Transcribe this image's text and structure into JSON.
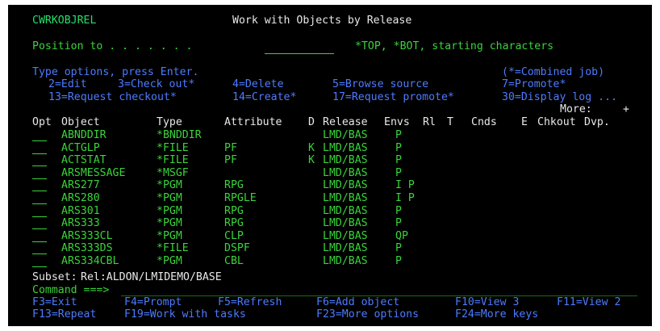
{
  "header": {
    "program": "CWRKOBJREL",
    "title": "Work with Objects by Release"
  },
  "position": {
    "label": "Position to . . . . . . .",
    "hint": "*TOP, *BOT, starting characters"
  },
  "instructions": {
    "text": "Type options, press Enter.",
    "combined": "(*=Combined job)"
  },
  "options_row1": [
    "2=Edit",
    "3=Check out*",
    "4=Delete",
    "5=Browse source",
    "7=Promote*"
  ],
  "options_row2": [
    "13=Request checkout*",
    "14=Create*",
    "17=Request promote*",
    "30=Display log ..."
  ],
  "more": "More:",
  "more_plus": "+",
  "columns": {
    "opt": "Opt",
    "object": "Object",
    "type": "Type",
    "attribute": "Attribute",
    "d": "D",
    "release": "Release",
    "envs": "Envs",
    "rl": "Rl",
    "t": "T",
    "cnds": "Cnds",
    "e": "E",
    "chkout": "Chkout",
    "dvp": "Dvp."
  },
  "rows": [
    {
      "object": "ABNDDIR",
      "type": "*BNDDIR",
      "attribute": "",
      "d": "",
      "release": "LMD/BAS",
      "envs": "P"
    },
    {
      "object": "ACTGLP",
      "type": "*FILE",
      "attribute": "PF",
      "d": "K",
      "release": "LMD/BAS",
      "envs": "P"
    },
    {
      "object": "ACTSTAT",
      "type": "*FILE",
      "attribute": "PF",
      "d": "K",
      "release": "LMD/BAS",
      "envs": "P"
    },
    {
      "object": "ARSMESSAGE",
      "type": "*MSGF",
      "attribute": "",
      "d": "",
      "release": "LMD/BAS",
      "envs": "P"
    },
    {
      "object": "ARS277",
      "type": "*PGM",
      "attribute": "RPG",
      "d": "",
      "release": "LMD/BAS",
      "envs": "I P"
    },
    {
      "object": "ARS280",
      "type": "*PGM",
      "attribute": "RPGLE",
      "d": "",
      "release": "LMD/BAS",
      "envs": "I P"
    },
    {
      "object": "ARS301",
      "type": "*PGM",
      "attribute": "RPG",
      "d": "",
      "release": "LMD/BAS",
      "envs": "P"
    },
    {
      "object": "ARS333",
      "type": "*PGM",
      "attribute": "RPG",
      "d": "",
      "release": "LMD/BAS",
      "envs": "P"
    },
    {
      "object": "ARS333CL",
      "type": "*PGM",
      "attribute": "CLP",
      "d": "",
      "release": "LMD/BAS",
      "envs": "QP"
    },
    {
      "object": "ARS333DS",
      "type": "*FILE",
      "attribute": "DSPF",
      "d": "",
      "release": "LMD/BAS",
      "envs": "P"
    },
    {
      "object": "ARS334CBL",
      "type": "*PGM",
      "attribute": "CBL",
      "d": "",
      "release": "LMD/BAS",
      "envs": "P"
    }
  ],
  "subset": {
    "label": "Subset:",
    "value": "Rel:ALDON/LMIDEMO/BASE"
  },
  "command": {
    "label": "Command ===>"
  },
  "fkeys_row1": [
    "F3=Exit",
    "F4=Prompt",
    "F5=Refresh",
    "F6=Add object",
    "F10=View 3",
    "F11=View 2"
  ],
  "fkeys_row2": [
    "F13=Repeat",
    "F19=Work with tasks",
    "F23=More options",
    "F24=More keys"
  ],
  "colors": {
    "background": "#000000",
    "green": "#3ad43a",
    "white": "#e8e8e8",
    "blue": "#4d7bff"
  }
}
